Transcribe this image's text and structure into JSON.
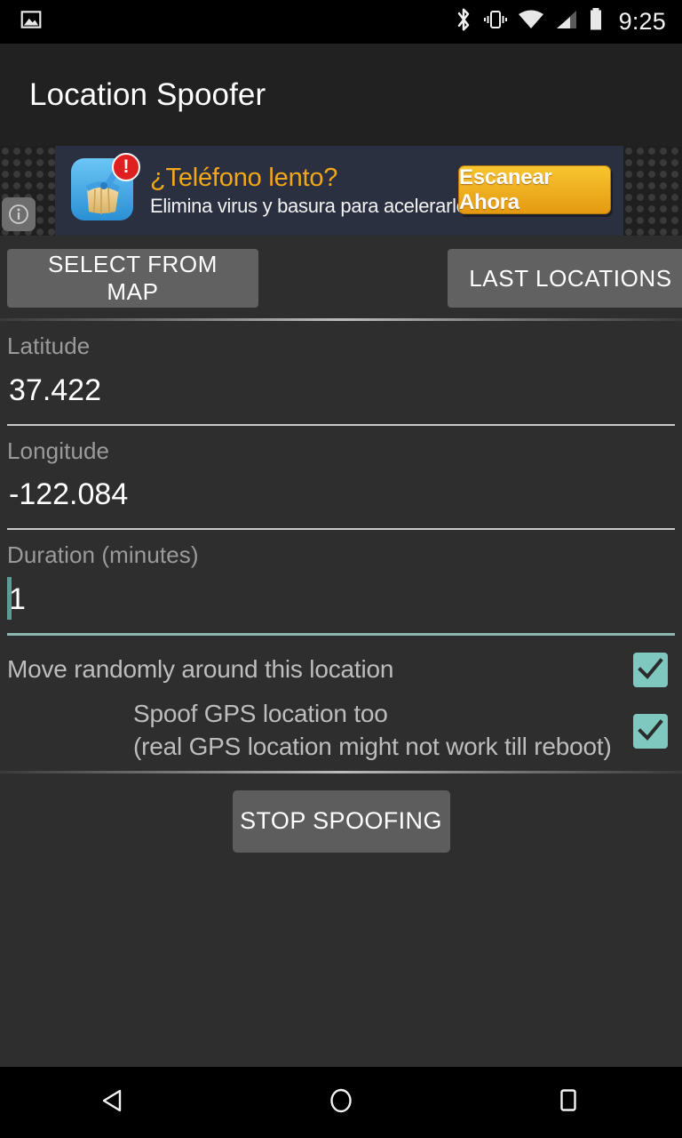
{
  "status_bar": {
    "left_icons": [
      {
        "name": "photo-image-icon"
      }
    ],
    "right_icons": [
      {
        "name": "bluetooth-icon"
      },
      {
        "name": "vibrate-icon"
      },
      {
        "name": "wifi-icon"
      },
      {
        "name": "cellular-signal-icon"
      },
      {
        "name": "battery-icon"
      }
    ],
    "clock": "9:25"
  },
  "action_bar": {
    "title": "Location Spoofer"
  },
  "ad": {
    "headline": "¿Teléfono lento?",
    "subtext": "Elimina virus y basura para acelerarlo",
    "cta_label": "Escanear Ahora",
    "badge": "!",
    "info_glyph": "ⓘ",
    "icon_name": "broom-cleaner-app-icon",
    "headline_color": "#f0a818",
    "cta_color": "#f0b51e",
    "panel_color": "#2b3041"
  },
  "toolbar": {
    "select_from_map_label": "SELECT FROM MAP",
    "last_locations_label": "LAST LOCATIONS"
  },
  "form": {
    "latitude": {
      "label": "Latitude",
      "value": "37.422"
    },
    "longitude": {
      "label": "Longitude",
      "value": "-122.084"
    },
    "duration": {
      "label": "Duration (minutes)",
      "value": "1",
      "focused": true,
      "accent_color": "#8cb7b1"
    }
  },
  "options": [
    {
      "label": "Move randomly around this location",
      "checked": true,
      "indented": false
    },
    {
      "label_line1": "Spoof GPS location too",
      "label_line2": "(real GPS location might not work till reboot)",
      "checked": true,
      "indented": true
    }
  ],
  "checkbox_color": "#7ec8c0",
  "actions": {
    "stop_spoofing_label": "STOP SPOOFING"
  },
  "nav_bar": {
    "back_label": "back-triangle",
    "home_label": "home-circle",
    "recents_label": "recents-square"
  }
}
